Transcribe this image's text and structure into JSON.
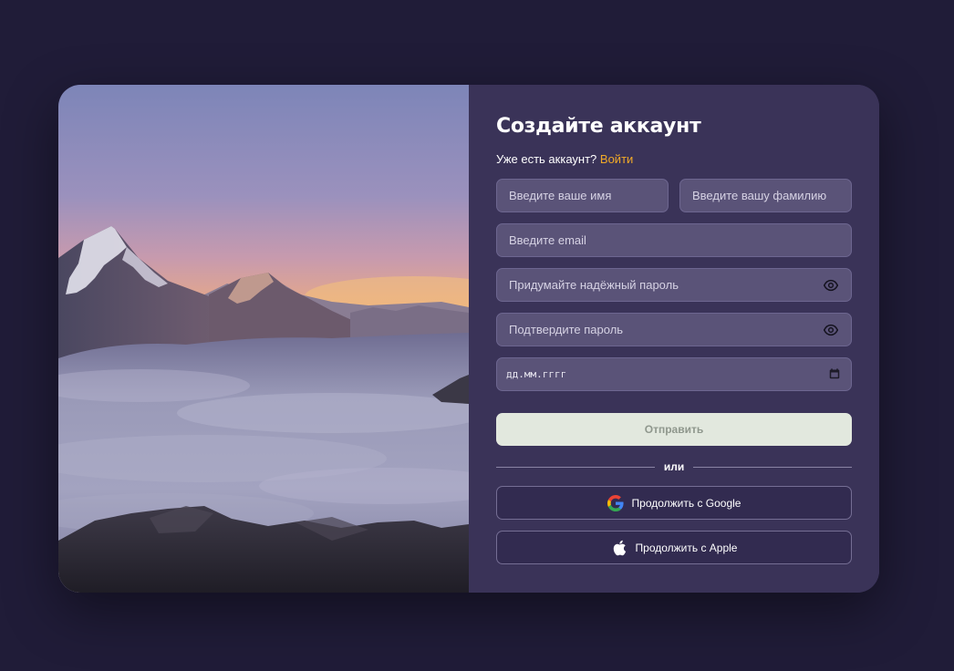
{
  "form": {
    "title": "Создайте аккаунт",
    "login_prompt": "Уже есть аккаунт?",
    "login_link": "Войти",
    "first_name_placeholder": "Введите ваше имя",
    "last_name_placeholder": "Введите вашу фамилию",
    "email_placeholder": "Введите email",
    "password_placeholder": "Придумайте надёжный пароль",
    "confirm_password_placeholder": "Подтвердите пароль",
    "date_placeholder": "дд.мм.гггг",
    "submit_label": "Отправить",
    "divider_label": "или",
    "google_label": "Продолжить с Google",
    "apple_label": "Продолжить с Apple"
  },
  "icons": {
    "password_toggle": "eye-icon",
    "confirm_toggle": "eye-icon",
    "date_picker": "calendar-icon",
    "google": "google-icon",
    "apple": "apple-icon"
  },
  "colors": {
    "page_background": "#201c38",
    "panel_background": "#3a3358",
    "input_background": "#5a5378",
    "accent_link": "#f0a928",
    "submit_background": "#e2e8de"
  }
}
